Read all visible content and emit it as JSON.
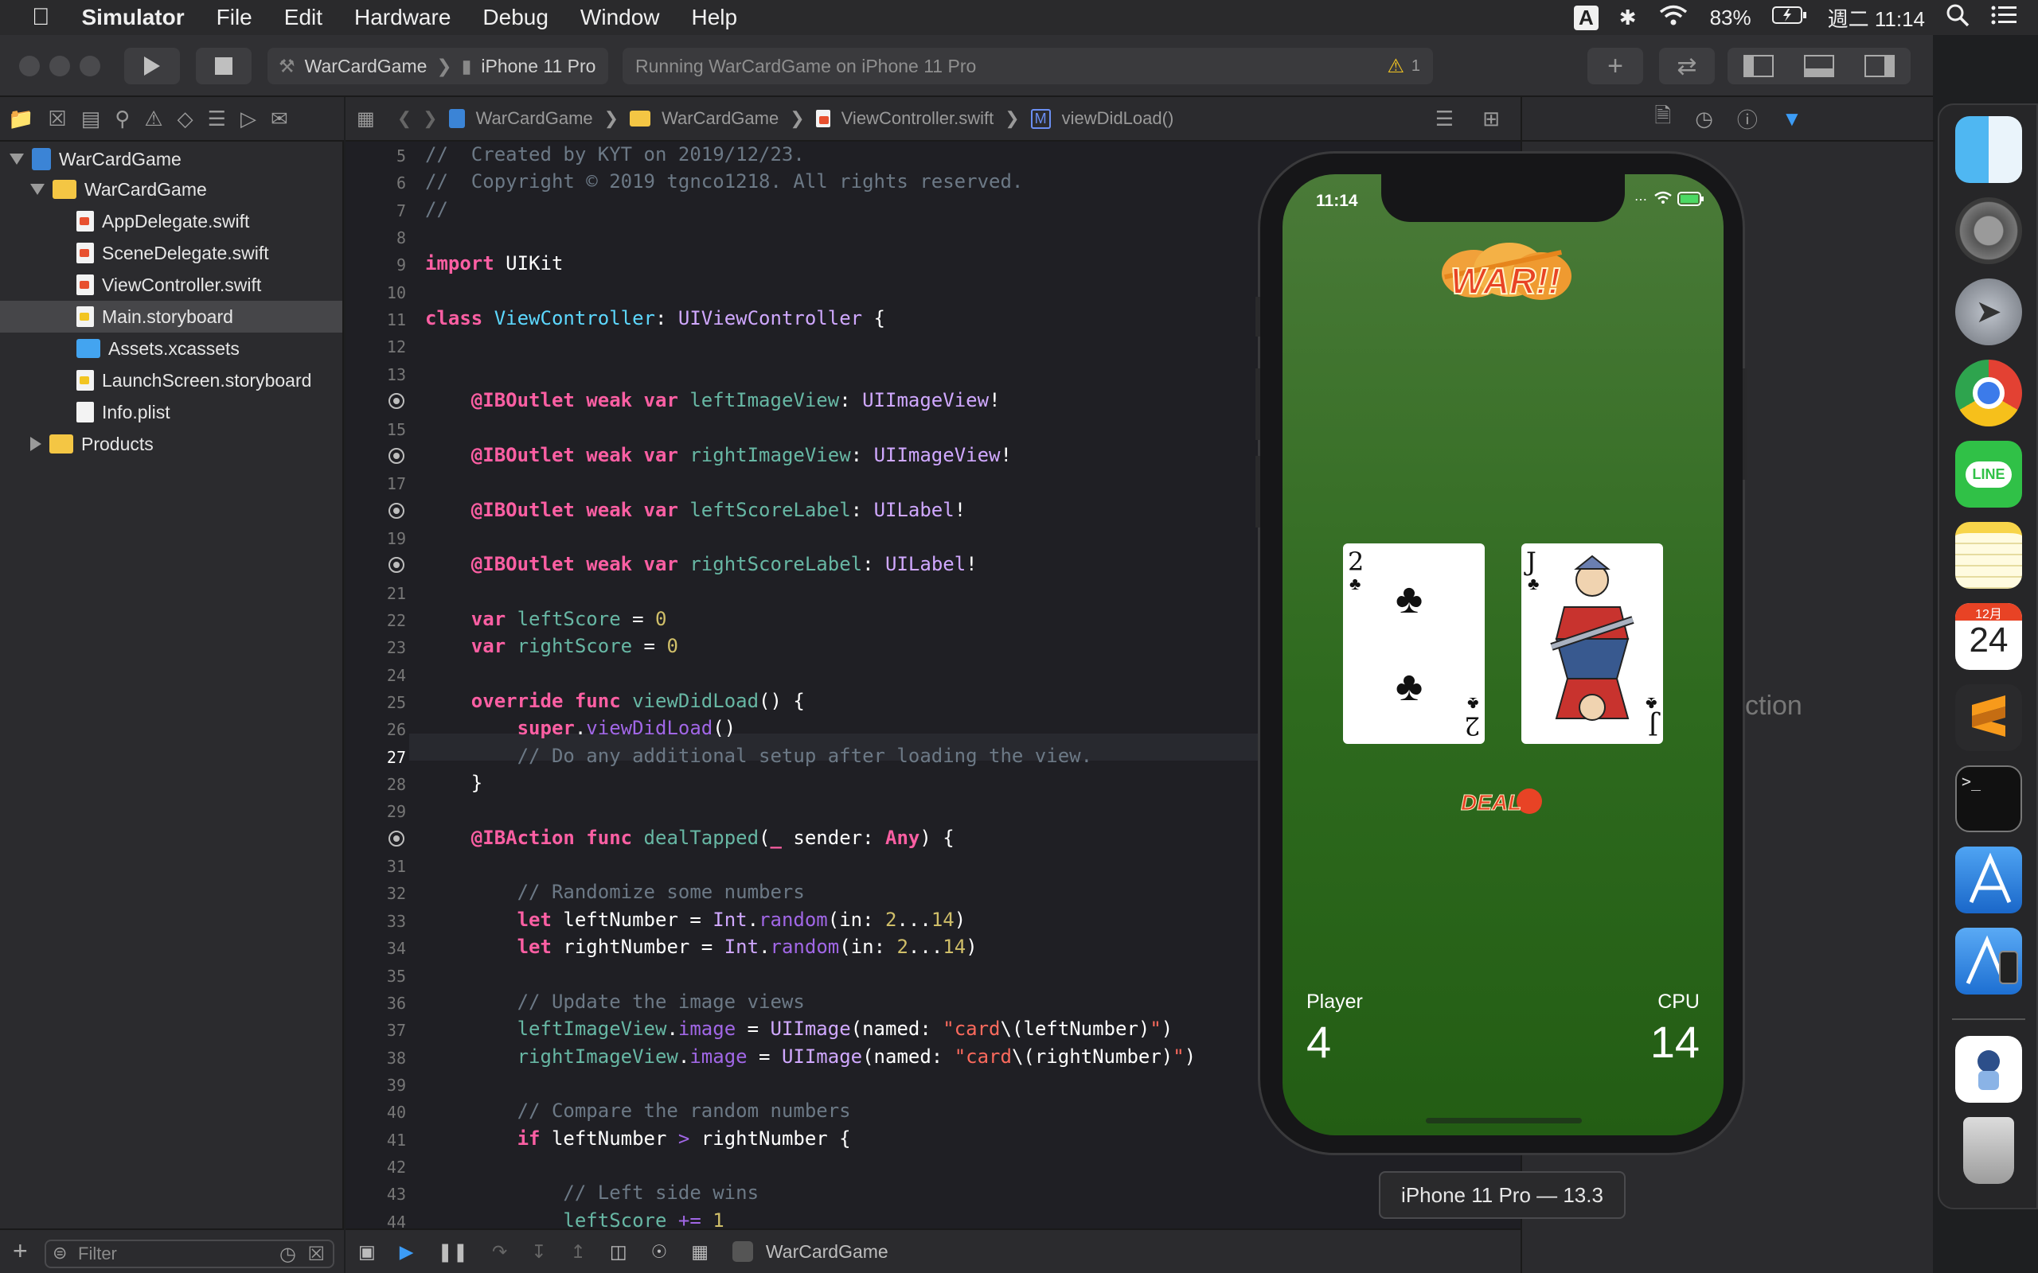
{
  "menubar": {
    "app": "Simulator",
    "items": [
      "File",
      "Edit",
      "Hardware",
      "Debug",
      "Window",
      "Help"
    ],
    "input_badge": "A",
    "battery": "83%",
    "clock": "週二 11:14"
  },
  "toolbar": {
    "scheme_target": "WarCardGame",
    "scheme_device": "iPhone 11 Pro",
    "activity": "Running WarCardGame on iPhone 11 Pro",
    "warning_count": "1"
  },
  "navigator": {
    "items": [
      {
        "label": "WarCardGame",
        "kind": "project",
        "indent": 0,
        "disclosure": "open"
      },
      {
        "label": "WarCardGame",
        "kind": "folder",
        "indent": 1,
        "disclosure": "open"
      },
      {
        "label": "AppDelegate.swift",
        "kind": "swift",
        "indent": 2
      },
      {
        "label": "SceneDelegate.swift",
        "kind": "swift",
        "indent": 2
      },
      {
        "label": "ViewController.swift",
        "kind": "swift",
        "indent": 2
      },
      {
        "label": "Main.storyboard",
        "kind": "storyboard",
        "indent": 2,
        "selected": true
      },
      {
        "label": "Assets.xcassets",
        "kind": "assets",
        "indent": 2
      },
      {
        "label": "LaunchScreen.storyboard",
        "kind": "storyboard",
        "indent": 2
      },
      {
        "label": "Info.plist",
        "kind": "plist",
        "indent": 2
      },
      {
        "label": "Products",
        "kind": "folder",
        "indent": 1,
        "disclosure": "closed"
      }
    ],
    "filter_placeholder": "Filter"
  },
  "jumpbar": {
    "crumbs": [
      "WarCardGame",
      "WarCardGame",
      "ViewController.swift",
      "viewDidLoad()"
    ]
  },
  "editor": {
    "current_line": 27,
    "lines": [
      {
        "n": "5",
        "html": "<span class='c'>//  Created by KYT on 2019/12/23.</span>"
      },
      {
        "n": "6",
        "html": "<span class='c'>//  Copyright © 2019 tgnco1218. All rights reserved.</span>"
      },
      {
        "n": "7",
        "html": "<span class='c'>//</span>"
      },
      {
        "n": "8",
        "html": ""
      },
      {
        "n": "9",
        "html": "<span class='k'>import</span> UIKit"
      },
      {
        "n": "10",
        "html": ""
      },
      {
        "n": "11",
        "html": "<span class='k'>class</span> <span class='ty'>ViewController</span>: <span class='t'>UIViewController</span> {"
      },
      {
        "n": "12",
        "html": ""
      },
      {
        "n": "13",
        "html": ""
      },
      {
        "n": "14",
        "bp": true,
        "html": "    <span class='k'>@IBOutlet</span> <span class='k'>weak</span> <span class='k'>var</span> <span class='v'>leftImageView</span>: <span class='t'>UIImageView</span>!"
      },
      {
        "n": "15",
        "html": ""
      },
      {
        "n": "16",
        "bp": true,
        "html": "    <span class='k'>@IBOutlet</span> <span class='k'>weak</span> <span class='k'>var</span> <span class='v'>rightImageView</span>: <span class='t'>UIImageView</span>!"
      },
      {
        "n": "17",
        "html": ""
      },
      {
        "n": "18",
        "bp": true,
        "html": "    <span class='k'>@IBOutlet</span> <span class='k'>weak</span> <span class='k'>var</span> <span class='v'>leftScoreLabel</span>: <span class='t'>UILabel</span>!"
      },
      {
        "n": "19",
        "html": ""
      },
      {
        "n": "20",
        "bp": true,
        "html": "    <span class='k'>@IBOutlet</span> <span class='k'>weak</span> <span class='k'>var</span> <span class='v'>rightScoreLabel</span>: <span class='t'>UILabel</span>!"
      },
      {
        "n": "21",
        "html": ""
      },
      {
        "n": "22",
        "html": "    <span class='k'>var</span> <span class='v'>leftScore</span> = <span class='n'>0</span>"
      },
      {
        "n": "23",
        "html": "    <span class='k'>var</span> <span class='v'>rightScore</span> = <span class='n'>0</span>"
      },
      {
        "n": "24",
        "html": ""
      },
      {
        "n": "25",
        "html": "    <span class='k'>override</span> <span class='k'>func</span> <span class='v'>viewDidLoad</span>() {"
      },
      {
        "n": "26",
        "html": "        <span class='k'>super</span>.<span class='m'>viewDidLoad</span>()"
      },
      {
        "n": "27",
        "html": "        <span class='c'>// Do any additional setup after loading the view.</span>"
      },
      {
        "n": "28",
        "html": "    }"
      },
      {
        "n": "29",
        "html": ""
      },
      {
        "n": "30",
        "bp": true,
        "html": "    <span class='k'>@IBAction</span> <span class='k'>func</span> <span class='v'>dealTapped</span>(<span class='k'>_</span> sender: <span class='k'>Any</span>) {"
      },
      {
        "n": "31",
        "html": ""
      },
      {
        "n": "32",
        "html": "        <span class='c'>// Randomize some numbers</span>"
      },
      {
        "n": "33",
        "html": "        <span class='k'>let</span> leftNumber = <span class='t'>Int</span>.<span class='m'>random</span>(in: <span class='n'>2</span>...<span class='n'>14</span>)"
      },
      {
        "n": "34",
        "html": "        <span class='k'>let</span> rightNumber = <span class='t'>Int</span>.<span class='m'>random</span>(in: <span class='n'>2</span>...<span class='n'>14</span>)"
      },
      {
        "n": "35",
        "html": ""
      },
      {
        "n": "36",
        "html": "        <span class='c'>// Update the image views</span>"
      },
      {
        "n": "37",
        "html": "        <span class='v'>leftImageView</span>.<span class='m'>image</span> = <span class='t'>UIImage</span>(named: <span class='s'>\"card</span>\\(leftNumber)<span class='s'>\"</span>)"
      },
      {
        "n": "38",
        "html": "        <span class='v'>rightImageView</span>.<span class='m'>image</span> = <span class='t'>UIImage</span>(named: <span class='s'>\"card</span>\\(rightNumber)<span class='s'>\"</span>)"
      },
      {
        "n": "39",
        "html": ""
      },
      {
        "n": "40",
        "html": "        <span class='c'>// Compare the random numbers</span>"
      },
      {
        "n": "41",
        "html": "        <span class='k'>if</span> leftNumber <span class='m'>&gt;</span> rightNumber {"
      },
      {
        "n": "42",
        "html": ""
      },
      {
        "n": "43",
        "html": "            <span class='c'>// Left side wins</span>"
      },
      {
        "n": "44",
        "html": "            <span class='v'>leftScore</span> <span class='m'>+=</span> <span class='n'>1</span>"
      }
    ]
  },
  "debugbar": {
    "target": "WarCardGame"
  },
  "inspector": {
    "partial_text": "ction"
  },
  "simulator": {
    "status_time": "11:14",
    "logo_text": "WAR!!",
    "left_card": {
      "rank": "2",
      "suit": "♣"
    },
    "right_card": {
      "rank": "J",
      "suit": "♣"
    },
    "deal_label": "DEAL",
    "player_label": "Player",
    "player_score": "4",
    "cpu_label": "CPU",
    "cpu_score": "14",
    "device_label": "iPhone 11 Pro — 13.3"
  },
  "dock": {
    "calendar_month": "12月",
    "calendar_day": "24",
    "line_label": "LINE",
    "terminal_prompt": ">_"
  }
}
